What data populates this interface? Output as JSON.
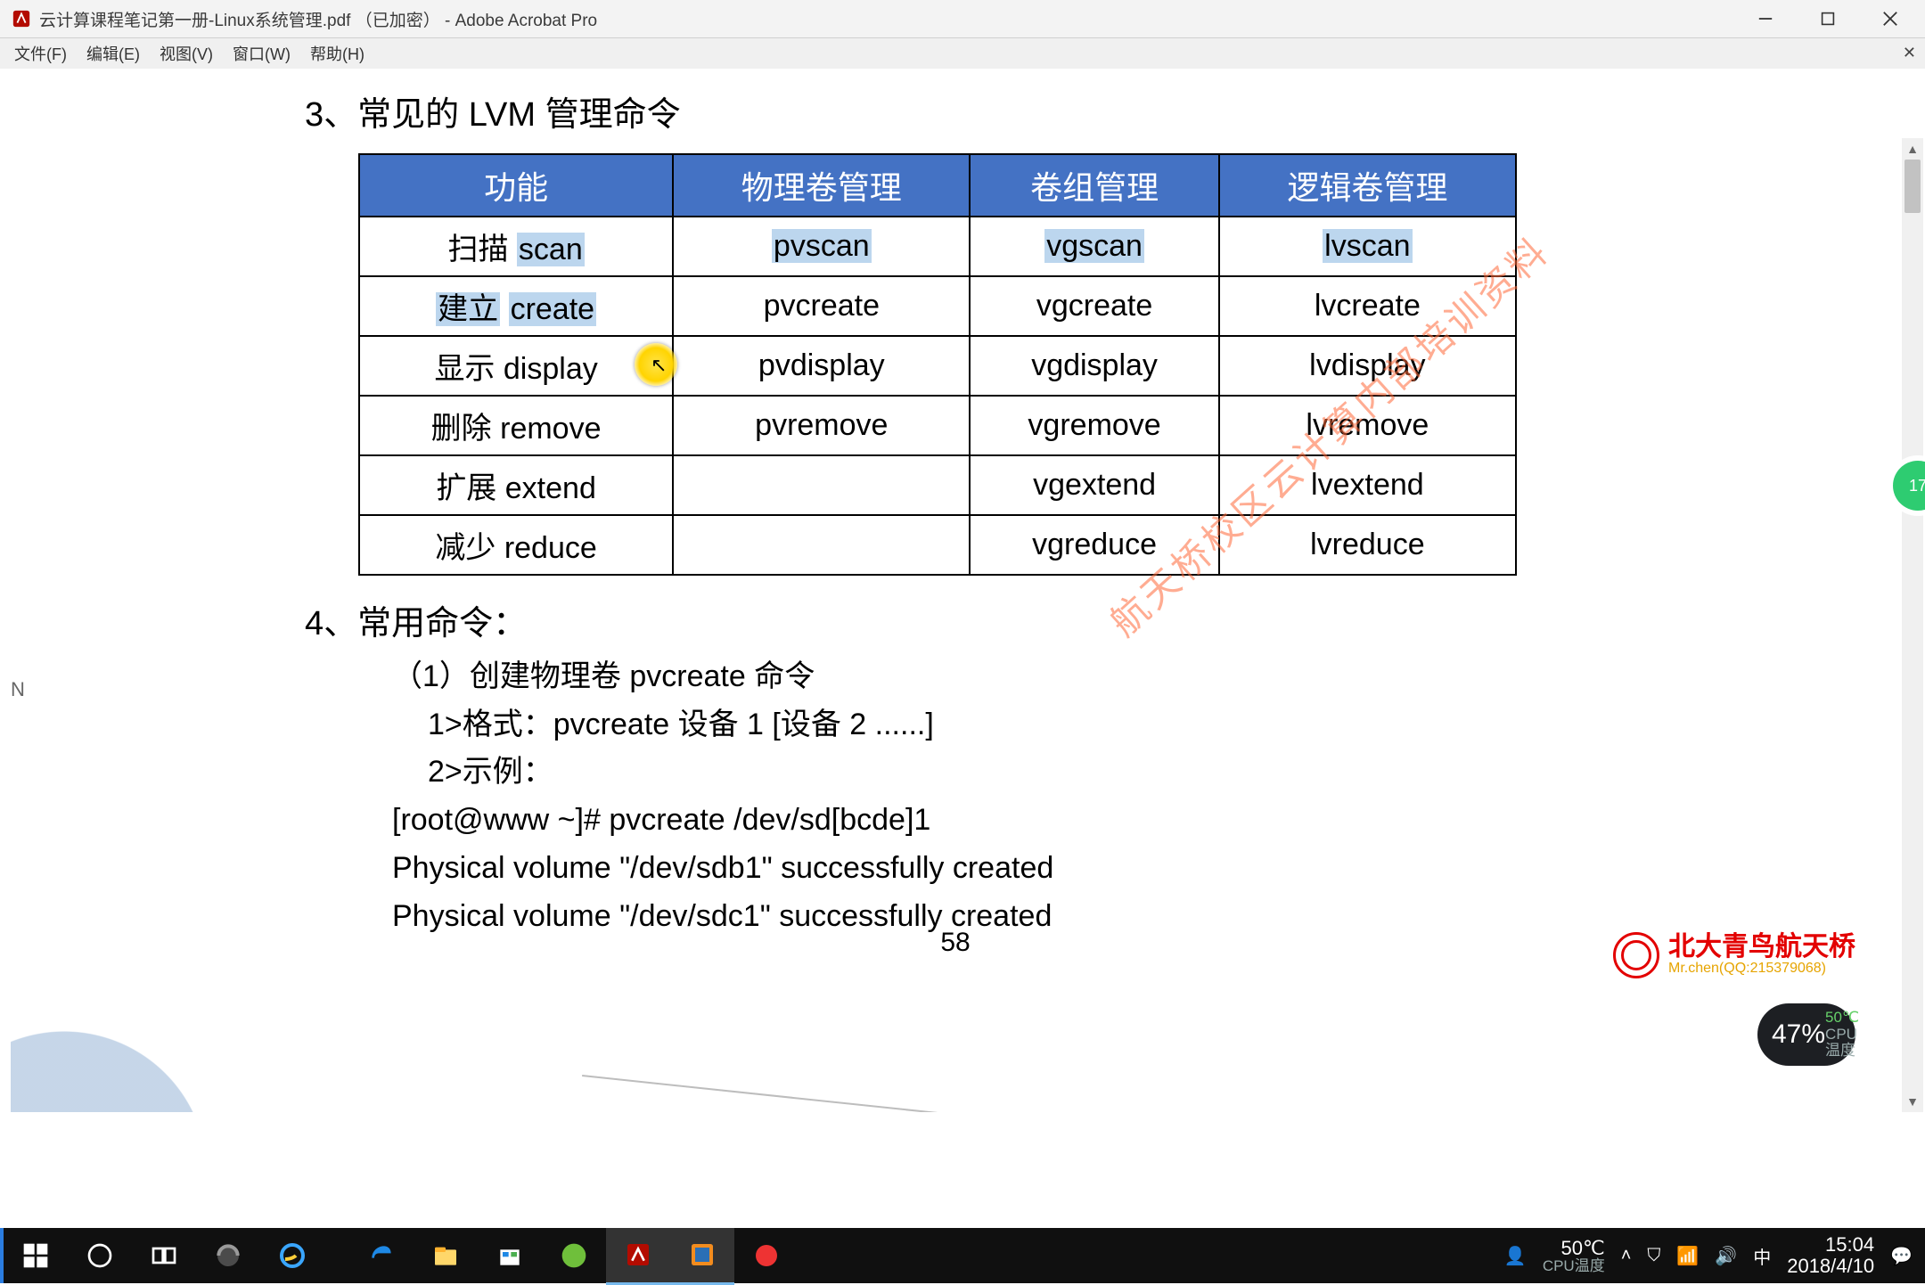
{
  "window": {
    "title": "云计算课程笔记第一册-Linux系统管理.pdf （已加密） - Adobe Acrobat Pro"
  },
  "menubar": [
    "文件(F)",
    "编辑(E)",
    "视图(V)",
    "窗口(W)",
    "帮助(H)"
  ],
  "doc": {
    "h3": "3、常见的 LVM 管理命令",
    "table": {
      "headers": [
        "功能",
        "物理卷管理",
        "卷组管理",
        "逻辑卷管理"
      ],
      "rows": [
        {
          "func_cn": "扫描",
          "func_en": "scan",
          "pv": "pvscan",
          "vg": "vgscan",
          "lv": "lvscan",
          "hl": [
            "func_en",
            "pv",
            "vg",
            "lv"
          ]
        },
        {
          "func_cn": "建立",
          "func_en": "create",
          "pv": "pvcreate",
          "vg": "vgcreate",
          "lv": "lvcreate",
          "hl": [
            "func_cn",
            "func_en"
          ]
        },
        {
          "func_cn": "显示",
          "func_en": "display",
          "pv": "pvdisplay",
          "vg": "vgdisplay",
          "lv": "lvdisplay",
          "hl": []
        },
        {
          "func_cn": "删除",
          "func_en": "remove",
          "pv": "pvremove",
          "vg": "vgremove",
          "lv": "lvremove",
          "hl": []
        },
        {
          "func_cn": "扩展",
          "func_en": "extend",
          "pv": "",
          "vg": "vgextend",
          "lv": "lvextend",
          "hl": []
        },
        {
          "func_cn": "减少",
          "func_en": "reduce",
          "pv": "",
          "vg": "vgreduce",
          "lv": "lvreduce",
          "hl": []
        }
      ]
    },
    "sec4_title": "4、常用命令：",
    "lines": [
      {
        "cls": "indent1",
        "t": "（1）创建物理卷  pvcreate 命令"
      },
      {
        "cls": "indent2",
        "t": "1>格式：pvcreate  设备 1 [设备 2 ......]"
      },
      {
        "cls": "indent2",
        "t": "2>示例："
      },
      {
        "cls": "indent1",
        "t": "[root@www ~]# pvcreate /dev/sd[bcde]1"
      },
      {
        "cls": "indent1",
        "t": "Physical volume \"/dev/sdb1\" successfully created"
      },
      {
        "cls": "indent1",
        "t": "  Physical volume \"/dev/sdc1\" successfully created"
      }
    ],
    "page_number": "58",
    "watermark": "航天桥校区云计算内部培训资料",
    "brand_name": "北大青鸟航天桥",
    "brand_sub": "Mr.chen(QQ:215379068)"
  },
  "gauge": {
    "big": "47%",
    "temp": "50℃",
    "label": "CPU温度"
  },
  "side_badge": "17",
  "tray": {
    "temp_val": "50℃",
    "temp_lbl": "CPU温度",
    "time": "15:04",
    "date": "2018/4/10"
  }
}
